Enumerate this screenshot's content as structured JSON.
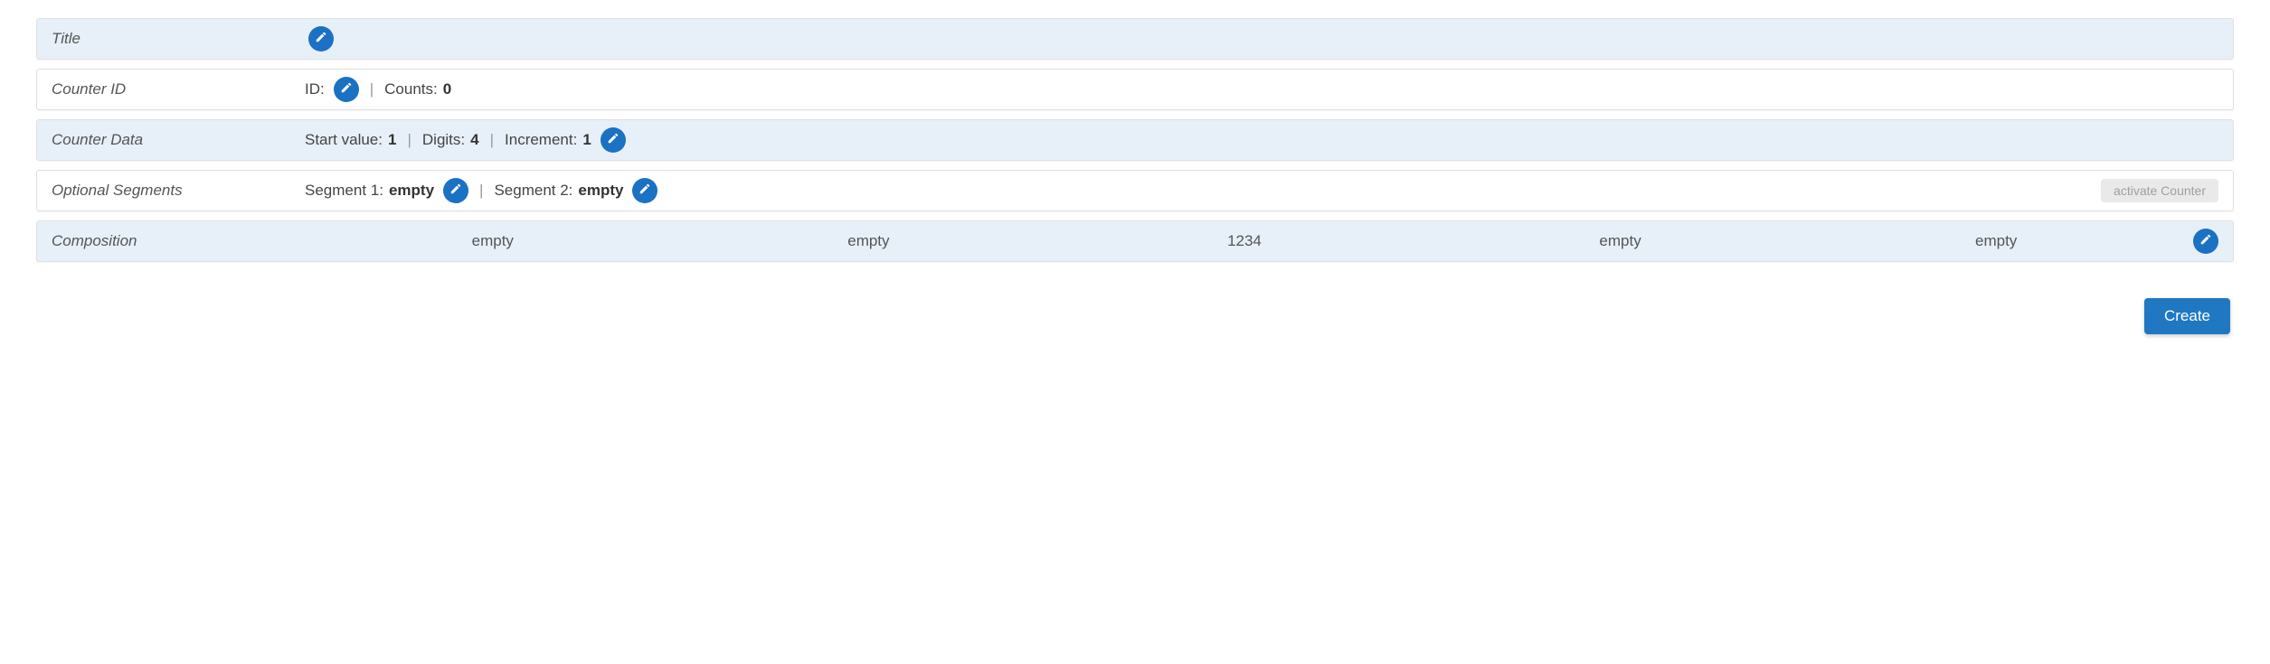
{
  "rows": {
    "title": {
      "label": "Title"
    },
    "counterId": {
      "label": "Counter ID",
      "idLabel": "ID:",
      "countsLabel": "Counts:",
      "countsValue": "0"
    },
    "counterData": {
      "label": "Counter Data",
      "startLabel": "Start value:",
      "startValue": "1",
      "digitsLabel": "Digits:",
      "digitsValue": "4",
      "incrementLabel": "Increment:",
      "incrementValue": "1"
    },
    "segments": {
      "label": "Optional Segments",
      "seg1Label": "Segment 1:",
      "seg1Value": "empty",
      "seg2Label": "Segment 2:",
      "seg2Value": "empty",
      "activateLabel": "activate Counter"
    },
    "composition": {
      "label": "Composition",
      "cells": [
        "empty",
        "empty",
        "1234",
        "empty",
        "empty"
      ]
    }
  },
  "footer": {
    "createLabel": "Create"
  },
  "separator": "|"
}
